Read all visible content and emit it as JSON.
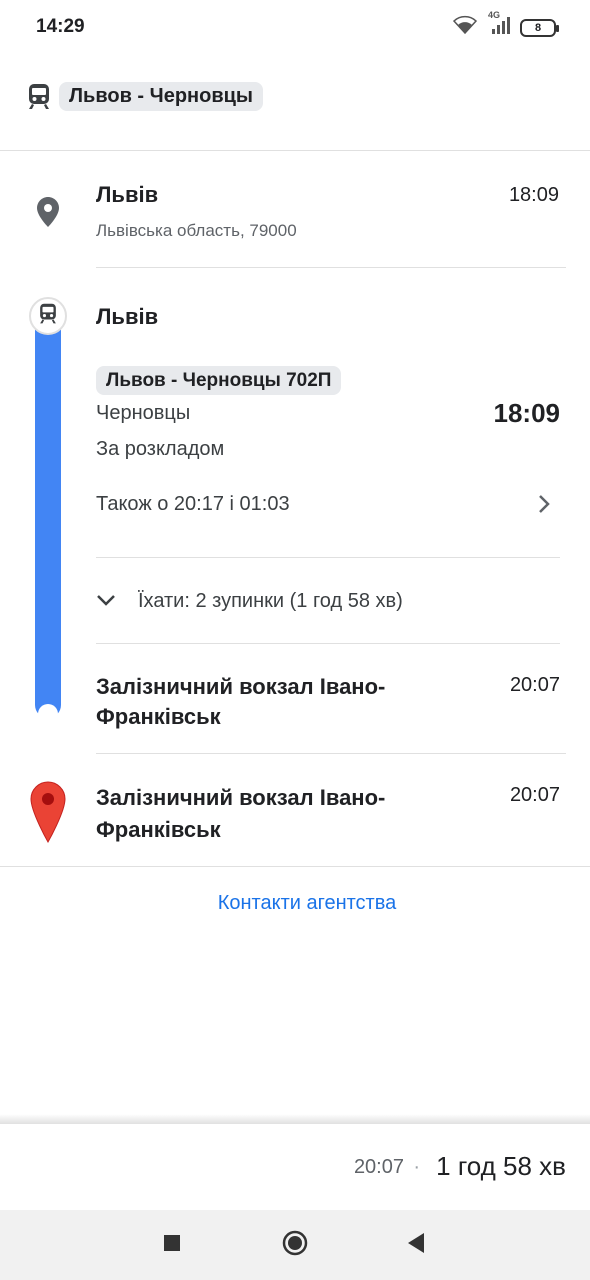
{
  "status_bar": {
    "time": "14:29",
    "network": "4G",
    "battery": "8"
  },
  "header": {
    "route_title": "Львов - Черновцы",
    "icon": "train-icon"
  },
  "origin": {
    "name": "Львів",
    "address": "Львівська область, 79000",
    "time": "18:09",
    "icon": "place-marker-icon"
  },
  "transit": {
    "board_stop": "Львів",
    "line_name": "Львов - Черновцы 702П",
    "headsign": "Черновцы",
    "departure_time": "18:09",
    "schedule_status": "За розкладом",
    "also_departures": "Також о 20:17 і 01:03",
    "ride_summary": "Їхати: 2 зупинки (1 год 58 хв)",
    "alight_stop": "Залізничний вокзал Івано-Франківськ",
    "alight_time": "20:07",
    "line_color": "#4285f4"
  },
  "destination": {
    "name": "Залізничний вокзал Івано-Франківськ",
    "time": "20:07",
    "icon": "red-pin-icon",
    "color": "#ea4335"
  },
  "agency_link": "Контакти агентства",
  "summary": {
    "arrival_time": "20:07",
    "separator": "·",
    "duration": "1 год 58 хв"
  }
}
